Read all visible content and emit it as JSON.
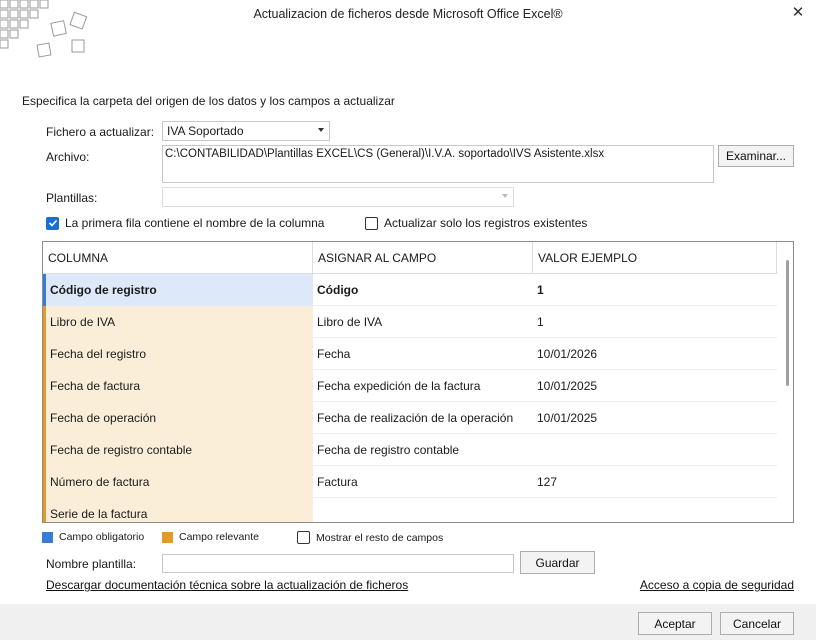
{
  "window": {
    "title": "Actualizacion de ficheros desde Microsoft Office Excel®",
    "close_glyph": "✕"
  },
  "instructions": "Especifica la carpeta del origen de los datos y los campos a actualizar",
  "form": {
    "fichero_label": "Fichero a actualizar:",
    "fichero_value": "IVA Soportado",
    "archivo_label": "Archivo:",
    "archivo_value": "C:\\CONTABILIDAD\\Plantillas EXCEL\\CS (General)\\I.V.A. soportado\\IVS Asistente.xlsx",
    "examinar_label": "Examinar...",
    "plantillas_label": "Plantillas:",
    "plantillas_value": ""
  },
  "checkboxes": {
    "first_row_label": "La primera fila contiene el nombre de la columna",
    "first_row_checked": true,
    "only_existing_label": "Actualizar solo los registros existentes",
    "only_existing_checked": false,
    "show_rest_label": "Mostrar el resto de campos",
    "show_rest_checked": false
  },
  "grid": {
    "headers": [
      "COLUMNA",
      "ASIGNAR AL CAMPO",
      "VALOR EJEMPLO"
    ],
    "rows": [
      {
        "columna": "Código de registro",
        "campo": "Código",
        "valor": "1",
        "kind": "req"
      },
      {
        "columna": "Libro de IVA",
        "campo": "Libro de IVA",
        "valor": "1",
        "kind": "rel"
      },
      {
        "columna": "Fecha del registro",
        "campo": "Fecha",
        "valor": "10/01/2026",
        "kind": "rel"
      },
      {
        "columna": "Fecha de factura",
        "campo": "Fecha expedición de la factura",
        "valor": "10/01/2025",
        "kind": "rel"
      },
      {
        "columna": "Fecha de operación",
        "campo": "Fecha de realización de la operación",
        "valor": "10/01/2025",
        "kind": "rel"
      },
      {
        "columna": "Fecha de registro contable",
        "campo": "Fecha de registro contable",
        "valor": "",
        "kind": "rel"
      },
      {
        "columna": "Número de factura",
        "campo": "Factura",
        "valor": "127",
        "kind": "rel"
      },
      {
        "columna": "Serie de la factura",
        "campo": "",
        "valor": "",
        "kind": "rel"
      }
    ]
  },
  "legend": {
    "obligatorio_label": "Campo obligatorio",
    "obligatorio_color": "#3a7bd5",
    "relevante_label": "Campo relevante",
    "relevante_color": "#e39a2b"
  },
  "plantilla": {
    "nombre_label": "Nombre plantilla:",
    "nombre_value": "",
    "guardar_label": "Guardar"
  },
  "links": {
    "doc_label": "Descargar documentación técnica sobre la actualización de ficheros",
    "backup_label": "Acceso a copia de seguridad"
  },
  "footer": {
    "aceptar_label": "Aceptar",
    "cancelar_label": "Cancelar"
  }
}
